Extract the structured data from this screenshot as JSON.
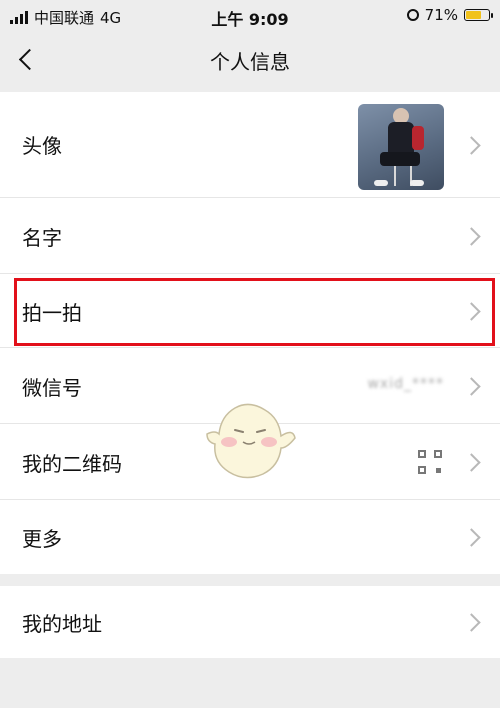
{
  "status_bar": {
    "carrier": "中国联通",
    "network": "4G",
    "time": "上午 9:09",
    "battery_percent": "71%",
    "battery_level": 0.71
  },
  "navbar": {
    "title": "个人信息"
  },
  "main_group": [
    {
      "label": "头像"
    },
    {
      "label": "名字"
    },
    {
      "label": "拍一拍"
    },
    {
      "label": "微信号",
      "value": "wxid_****"
    },
    {
      "label": "我的二维码"
    },
    {
      "label": "更多"
    }
  ],
  "second_group": [
    {
      "label": "我的地址"
    }
  ],
  "colors": {
    "highlight": "#e2101a",
    "battery": "#f1c21b",
    "background": "#ededed"
  }
}
